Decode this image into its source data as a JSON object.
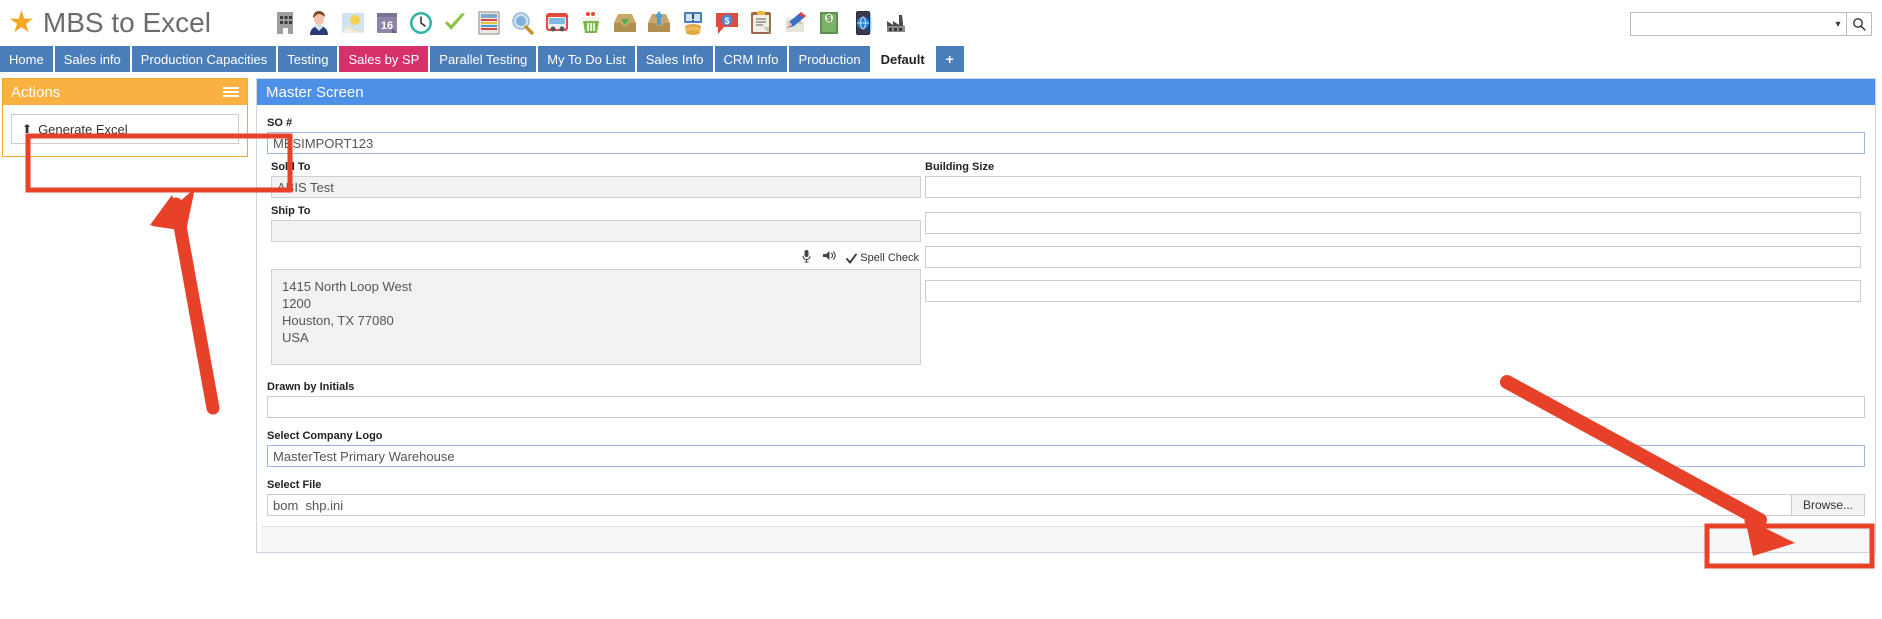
{
  "app": {
    "title": "MBS to Excel",
    "star_icon": "star-icon"
  },
  "toolbar": {
    "icons": [
      {
        "name": "building-icon",
        "title": "Company"
      },
      {
        "name": "person-icon",
        "title": "Contact"
      },
      {
        "name": "weather-icon",
        "title": "Weather"
      },
      {
        "name": "calendar-16-icon",
        "title": "Calendar",
        "label": "16"
      },
      {
        "name": "clock-icon",
        "title": "Time Clock"
      },
      {
        "name": "checkmark-icon",
        "title": "Approve"
      },
      {
        "name": "spreadsheet-icon",
        "title": "Spreadsheet"
      },
      {
        "name": "magnifier-globe-icon",
        "title": "Search Web"
      },
      {
        "name": "truck-icon",
        "title": "Shipping"
      },
      {
        "name": "trash-basket-icon",
        "title": "Delete"
      },
      {
        "name": "inbox-download-icon",
        "title": "Receive"
      },
      {
        "name": "inbox-upload-icon",
        "title": "Send"
      },
      {
        "name": "coins-monitor-icon",
        "title": "Billing"
      },
      {
        "name": "dollar-chat-icon",
        "title": "Quote"
      },
      {
        "name": "clipboard-icon",
        "title": "Notes"
      },
      {
        "name": "pencil-icon",
        "title": "Edit"
      },
      {
        "name": "money-icon",
        "title": "Payments"
      },
      {
        "name": "globe-phone-icon",
        "title": "Web"
      },
      {
        "name": "factory-icon",
        "title": "Production"
      }
    ]
  },
  "search": {
    "value": "",
    "placeholder": "",
    "caret_icon": "chevron-down-icon",
    "button_icon": "search-icon"
  },
  "nav": {
    "tabs": [
      {
        "label": "Home",
        "style": "blue"
      },
      {
        "label": "Sales info",
        "style": "blue"
      },
      {
        "label": "Production Capacities",
        "style": "blue"
      },
      {
        "label": "Testing",
        "style": "blue"
      },
      {
        "label": "Sales by SP",
        "style": "pink"
      },
      {
        "label": "Parallel Testing",
        "style": "blue"
      },
      {
        "label": "My To Do List",
        "style": "blue"
      },
      {
        "label": "Sales Info",
        "style": "blue"
      },
      {
        "label": "CRM Info",
        "style": "blue"
      },
      {
        "label": "Production",
        "style": "blue"
      },
      {
        "label": "Default",
        "style": "active"
      },
      {
        "label": "+",
        "style": "plus"
      }
    ]
  },
  "actions": {
    "title": "Actions",
    "menu_icon": "hamburger-icon",
    "items": [
      {
        "label": "Generate Excel",
        "icon": "upload-icon"
      }
    ]
  },
  "master": {
    "title": "Master Screen",
    "fields": {
      "so_number": {
        "label": "SO #",
        "value": "MBSIMPORT123"
      },
      "sold_to": {
        "label": "Sold To",
        "value": "ABIS Test"
      },
      "ship_to": {
        "label": "Ship To",
        "value": ""
      },
      "building_size": {
        "label": "Building Size",
        "value": ""
      },
      "right_field_2": {
        "value": ""
      },
      "right_field_3": {
        "value": ""
      },
      "right_field_4": {
        "value": ""
      },
      "address": {
        "value": "1415 North Loop West\n1200\nHouston, TX 77080\nUSA"
      },
      "drawn_by_initials": {
        "label": "Drawn by Initials",
        "value": ""
      },
      "select_company_logo": {
        "label": "Select Company Logo",
        "value": "MasterTest Primary Warehouse"
      },
      "select_file": {
        "label": "Select File",
        "value": "bom  shp.ini"
      }
    },
    "spellcheck": {
      "label": "Spell Check",
      "check_icon": "checkmark-icon",
      "mic_icon": "microphone-icon",
      "speaker_icon": "speaker-icon"
    },
    "browse_button": {
      "label": "Browse..."
    }
  },
  "annotations": {
    "highlight_color": "#e8412a",
    "boxes": [
      {
        "name": "generate-excel-highlight"
      },
      {
        "name": "browse-button-highlight"
      }
    ],
    "arrows": [
      {
        "name": "arrow-to-generate-excel"
      },
      {
        "name": "arrow-to-browse-button"
      }
    ]
  }
}
